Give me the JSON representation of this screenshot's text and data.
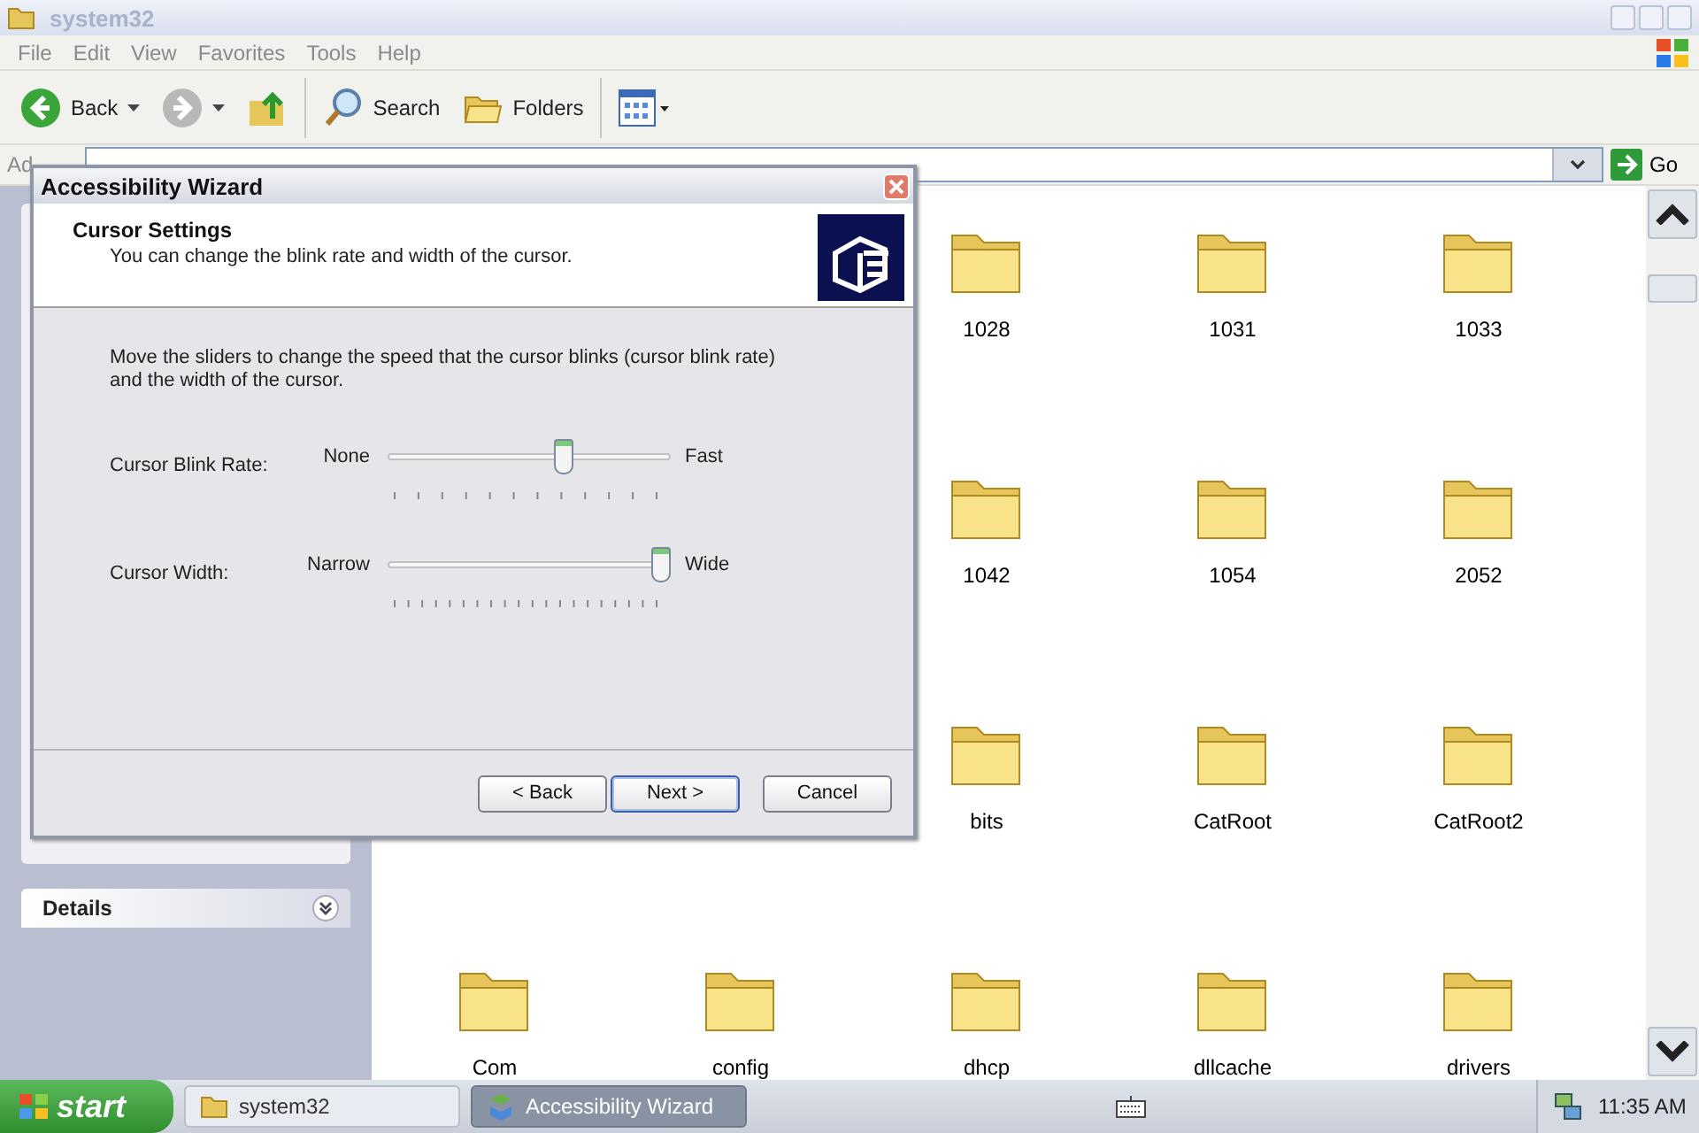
{
  "explorer": {
    "title": "system32"
  },
  "menu": [
    "File",
    "Edit",
    "View",
    "Favorites",
    "Tools",
    "Help"
  ],
  "toolbar": [
    {
      "kind": "back",
      "label": "Back"
    },
    {
      "kind": "forward"
    },
    {
      "kind": "up"
    },
    {
      "kind": "search",
      "label": "Search"
    },
    {
      "kind": "folders",
      "label": "Folders"
    },
    {
      "kind": "views"
    }
  ],
  "address": {
    "label": "Ad",
    "go": "Go"
  },
  "side_panels": [
    {
      "title": "Details",
      "expanded": false
    }
  ],
  "folder_rows": [
    [
      "1028",
      "1031",
      "1033"
    ],
    [
      "1042",
      "1054",
      "2052"
    ],
    [
      "bits",
      "CatRoot",
      "CatRoot2"
    ],
    [
      "Com",
      "config",
      "dhcp",
      "dllcache",
      "drivers"
    ]
  ],
  "dialog": {
    "title": "Accessibility Wizard",
    "heading": "Cursor Settings",
    "subheading": "You can change the blink rate and width of the cursor.",
    "instructions": "Move the sliders to change the speed that the cursor blinks (cursor blink rate) and the width of the cursor.",
    "sliders": [
      {
        "kind": "coarse",
        "label": "Cursor Blink Rate:",
        "min": "None",
        "max": "Fast",
        "level": 0.63
      },
      {
        "kind": "fine",
        "label": "Cursor Width:",
        "min": "Narrow",
        "max": "Wide",
        "level": 1
      }
    ],
    "buttons": [
      {
        "label": "< Back",
        "default": false
      },
      {
        "label": "Next >",
        "default": true
      },
      {
        "label": "Cancel",
        "default": false
      }
    ]
  },
  "taskbar": {
    "start": "start",
    "tasks": [
      {
        "label": "system32",
        "selected": false
      },
      {
        "label": "Accessibility Wizard",
        "selected": true
      }
    ],
    "clock": "11:35 AM"
  }
}
